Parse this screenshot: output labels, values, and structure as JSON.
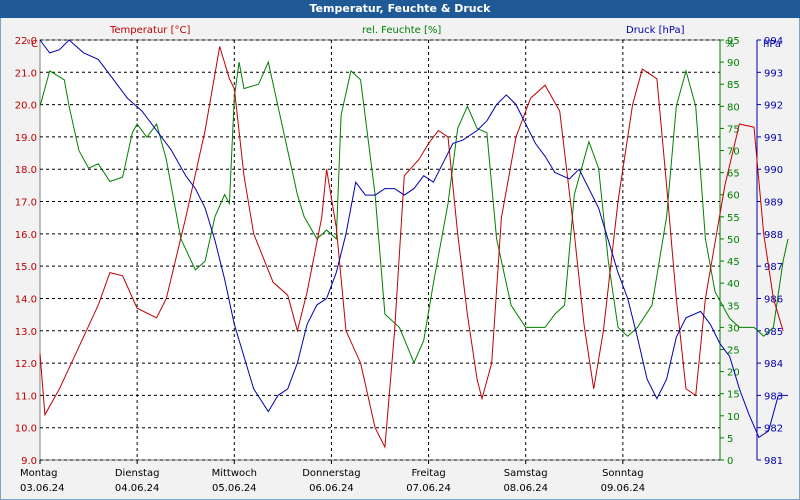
{
  "window": {
    "title": "Temperatur, Feuchte & Druck"
  },
  "chart_data": {
    "type": "line",
    "series_labels": {
      "temp": "Temperatur [°C]",
      "hum": "rel. Feuchte [%]",
      "press": "Druck [hPa]"
    },
    "axis_units": {
      "left": "°C",
      "right1": "%",
      "right2": "hPa"
    },
    "colors": {
      "temp": "#c00000",
      "hum": "#008000",
      "press": "#0000b0",
      "grid": "#000000"
    },
    "y_left": {
      "min": 9,
      "max": 22,
      "ticks": [
        "9.0",
        "10.0",
        "11.0",
        "12.0",
        "13.0",
        "14.0",
        "15.0",
        "16.0",
        "17.0",
        "18.0",
        "19.0",
        "20.0",
        "21.0",
        "22.0"
      ]
    },
    "y_right1": {
      "min": 0,
      "max": 95,
      "ticks": [
        "0",
        "5",
        "10",
        "15",
        "20",
        "25",
        "30",
        "35",
        "40",
        "45",
        "50",
        "55",
        "60",
        "65",
        "70",
        "75",
        "80",
        "85",
        "90",
        "95"
      ]
    },
    "y_right2": {
      "min": 981,
      "max": 994,
      "ticks": [
        "981",
        "982",
        "983",
        "984",
        "985",
        "986",
        "987",
        "988",
        "989",
        "990",
        "991",
        "992",
        "993",
        "994"
      ]
    },
    "x_categories": [
      {
        "day": "Montag",
        "date": "03.06.24"
      },
      {
        "day": "Dienstag",
        "date": "04.06.24"
      },
      {
        "day": "Mittwoch",
        "date": "05.06.24"
      },
      {
        "day": "Donnerstag",
        "date": "06.06.24"
      },
      {
        "day": "Freitag",
        "date": "07.06.24"
      },
      {
        "day": "Samstag",
        "date": "08.06.24"
      },
      {
        "day": "Sonntag",
        "date": "09.06.24"
      }
    ],
    "temperature": [
      [
        0,
        12.3
      ],
      [
        0.05,
        10.4
      ],
      [
        0.2,
        11.2
      ],
      [
        0.4,
        12.5
      ],
      [
        0.6,
        13.8
      ],
      [
        0.72,
        14.8
      ],
      [
        0.85,
        14.7
      ],
      [
        1.0,
        13.7
      ],
      [
        1.2,
        13.4
      ],
      [
        1.3,
        14.0
      ],
      [
        1.5,
        16.5
      ],
      [
        1.7,
        19.2
      ],
      [
        1.85,
        21.8
      ],
      [
        1.95,
        20.8
      ],
      [
        2.0,
        20.5
      ],
      [
        2.1,
        17.8
      ],
      [
        2.2,
        16.0
      ],
      [
        2.4,
        14.5
      ],
      [
        2.55,
        14.1
      ],
      [
        2.65,
        13.0
      ],
      [
        2.75,
        14.2
      ],
      [
        2.9,
        16.5
      ],
      [
        2.95,
        18.0
      ],
      [
        3.05,
        16.2
      ],
      [
        3.15,
        13.0
      ],
      [
        3.3,
        12.0
      ],
      [
        3.45,
        10.0
      ],
      [
        3.55,
        9.4
      ],
      [
        3.65,
        13.0
      ],
      [
        3.75,
        17.8
      ],
      [
        3.9,
        18.3
      ],
      [
        4.0,
        18.8
      ],
      [
        4.1,
        19.2
      ],
      [
        4.2,
        19.0
      ],
      [
        4.3,
        16.0
      ],
      [
        4.4,
        13.5
      ],
      [
        4.5,
        11.5
      ],
      [
        4.55,
        10.9
      ],
      [
        4.65,
        12.0
      ],
      [
        4.75,
        16.5
      ],
      [
        4.9,
        19.0
      ],
      [
        5.05,
        20.2
      ],
      [
        5.2,
        20.6
      ],
      [
        5.35,
        19.8
      ],
      [
        5.5,
        16.0
      ],
      [
        5.6,
        13.2
      ],
      [
        5.7,
        11.2
      ],
      [
        5.8,
        13.0
      ],
      [
        5.95,
        17.0
      ],
      [
        6.1,
        20.0
      ],
      [
        6.2,
        21.1
      ],
      [
        6.35,
        20.8
      ],
      [
        6.45,
        17.5
      ],
      [
        6.55,
        14.0
      ],
      [
        6.65,
        11.2
      ],
      [
        6.75,
        11.0
      ],
      [
        6.85,
        14.0
      ],
      [
        7.05,
        17.5
      ],
      [
        7.2,
        19.4
      ],
      [
        7.35,
        19.3
      ],
      [
        7.45,
        16.0
      ],
      [
        7.55,
        14.0
      ],
      [
        7.65,
        13.0
      ]
    ],
    "humidity": [
      [
        0,
        80
      ],
      [
        0.1,
        88
      ],
      [
        0.25,
        86
      ],
      [
        0.3,
        80
      ],
      [
        0.4,
        70
      ],
      [
        0.5,
        66
      ],
      [
        0.6,
        67
      ],
      [
        0.72,
        63
      ],
      [
        0.85,
        64
      ],
      [
        0.95,
        74
      ],
      [
        1.0,
        76
      ],
      [
        1.1,
        73
      ],
      [
        1.2,
        76
      ],
      [
        1.3,
        68
      ],
      [
        1.45,
        50
      ],
      [
        1.6,
        43
      ],
      [
        1.7,
        45
      ],
      [
        1.8,
        55
      ],
      [
        1.9,
        60
      ],
      [
        1.95,
        58
      ],
      [
        2.0,
        82
      ],
      [
        2.05,
        90
      ],
      [
        2.1,
        84
      ],
      [
        2.25,
        85
      ],
      [
        2.35,
        90
      ],
      [
        2.45,
        80
      ],
      [
        2.55,
        70
      ],
      [
        2.65,
        60
      ],
      [
        2.72,
        55
      ],
      [
        2.85,
        50
      ],
      [
        2.95,
        52
      ],
      [
        3.05,
        50
      ],
      [
        3.1,
        78
      ],
      [
        3.2,
        88
      ],
      [
        3.3,
        86
      ],
      [
        3.45,
        60
      ],
      [
        3.55,
        33
      ],
      [
        3.7,
        30
      ],
      [
        3.85,
        22
      ],
      [
        3.95,
        27
      ],
      [
        4.05,
        40
      ],
      [
        4.2,
        58
      ],
      [
        4.3,
        75
      ],
      [
        4.4,
        80
      ],
      [
        4.5,
        75
      ],
      [
        4.6,
        74
      ],
      [
        4.7,
        50
      ],
      [
        4.85,
        35
      ],
      [
        5.0,
        30
      ],
      [
        5.2,
        30
      ],
      [
        5.3,
        33
      ],
      [
        5.4,
        35
      ],
      [
        5.5,
        60
      ],
      [
        5.65,
        72
      ],
      [
        5.75,
        66
      ],
      [
        5.85,
        45
      ],
      [
        5.95,
        30
      ],
      [
        6.05,
        28
      ],
      [
        6.15,
        30
      ],
      [
        6.3,
        35
      ],
      [
        6.45,
        55
      ],
      [
        6.55,
        80
      ],
      [
        6.65,
        88
      ],
      [
        6.75,
        80
      ],
      [
        6.85,
        50
      ],
      [
        6.95,
        38
      ],
      [
        7.1,
        32
      ],
      [
        7.2,
        30
      ],
      [
        7.35,
        30
      ],
      [
        7.45,
        28
      ],
      [
        7.55,
        30
      ],
      [
        7.65,
        45
      ],
      [
        7.7,
        50
      ]
    ],
    "pressure": [
      [
        0,
        994.0
      ],
      [
        0.1,
        993.6
      ],
      [
        0.2,
        993.7
      ],
      [
        0.3,
        994.0
      ],
      [
        0.45,
        993.6
      ],
      [
        0.6,
        993.4
      ],
      [
        0.75,
        992.8
      ],
      [
        0.9,
        992.2
      ],
      [
        1.05,
        991.8
      ],
      [
        1.2,
        991.2
      ],
      [
        1.35,
        990.6
      ],
      [
        1.5,
        989.8
      ],
      [
        1.6,
        989.4
      ],
      [
        1.7,
        988.8
      ],
      [
        1.8,
        987.8
      ],
      [
        1.9,
        986.6
      ],
      [
        2.0,
        985.2
      ],
      [
        2.1,
        984.2
      ],
      [
        2.2,
        983.2
      ],
      [
        2.35,
        982.5
      ],
      [
        2.45,
        983.0
      ],
      [
        2.55,
        983.2
      ],
      [
        2.65,
        984.0
      ],
      [
        2.75,
        985.2
      ],
      [
        2.85,
        985.8
      ],
      [
        2.95,
        986.0
      ],
      [
        3.05,
        986.8
      ],
      [
        3.15,
        988.0
      ],
      [
        3.25,
        989.6
      ],
      [
        3.35,
        989.2
      ],
      [
        3.45,
        989.2
      ],
      [
        3.55,
        989.4
      ],
      [
        3.65,
        989.4
      ],
      [
        3.75,
        989.2
      ],
      [
        3.85,
        989.4
      ],
      [
        3.95,
        989.8
      ],
      [
        4.05,
        989.6
      ],
      [
        4.15,
        990.2
      ],
      [
        4.25,
        990.8
      ],
      [
        4.35,
        990.9
      ],
      [
        4.5,
        991.2
      ],
      [
        4.6,
        991.5
      ],
      [
        4.7,
        992.0
      ],
      [
        4.8,
        992.3
      ],
      [
        4.9,
        992.0
      ],
      [
        5.0,
        991.4
      ],
      [
        5.1,
        990.8
      ],
      [
        5.2,
        990.4
      ],
      [
        5.3,
        989.9
      ],
      [
        5.45,
        989.7
      ],
      [
        5.55,
        990.0
      ],
      [
        5.65,
        989.4
      ],
      [
        5.75,
        988.8
      ],
      [
        5.85,
        987.8
      ],
      [
        5.95,
        986.8
      ],
      [
        6.05,
        986.0
      ],
      [
        6.15,
        984.8
      ],
      [
        6.25,
        983.5
      ],
      [
        6.35,
        982.9
      ],
      [
        6.45,
        983.5
      ],
      [
        6.55,
        984.8
      ],
      [
        6.65,
        985.4
      ],
      [
        6.8,
        985.6
      ],
      [
        6.9,
        985.2
      ],
      [
        7.0,
        984.6
      ],
      [
        7.1,
        984.2
      ],
      [
        7.2,
        983.2
      ],
      [
        7.3,
        982.4
      ],
      [
        7.4,
        981.7
      ],
      [
        7.5,
        981.9
      ],
      [
        7.6,
        983.0
      ],
      [
        7.7,
        983.0
      ]
    ]
  }
}
